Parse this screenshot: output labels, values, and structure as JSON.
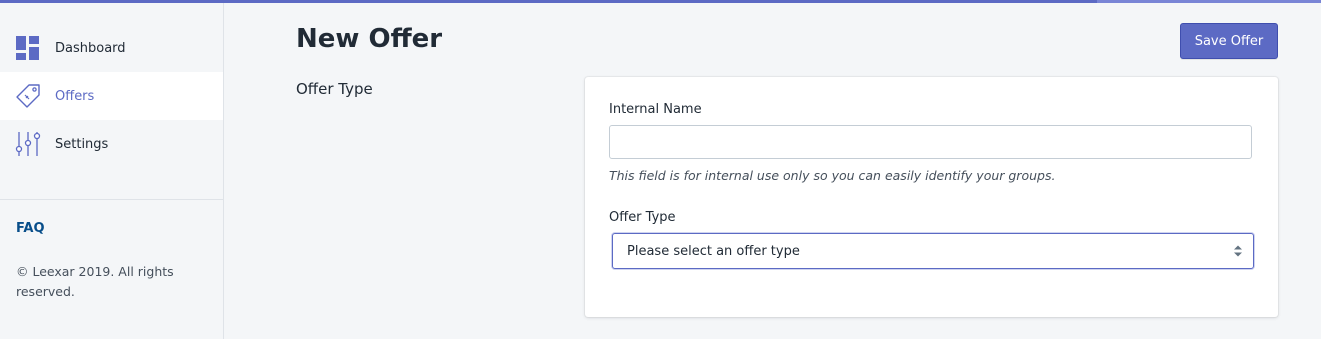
{
  "sidebar": {
    "items": [
      {
        "label": "Dashboard",
        "icon": "dashboard-icon"
      },
      {
        "label": "Offers",
        "icon": "tag-icon",
        "active": true
      },
      {
        "label": "Settings",
        "icon": "sliders-icon"
      }
    ],
    "faq_label": "FAQ",
    "copyright": "© Leexar 2019. All rights reserved."
  },
  "header": {
    "title": "New Offer",
    "save_label": "Save Offer"
  },
  "section": {
    "title": "Offer Type"
  },
  "form": {
    "internal_name_label": "Internal Name",
    "internal_name_value": "",
    "internal_name_help": "This field is for internal use only so you can easily identify your groups.",
    "offer_type_label": "Offer Type",
    "offer_type_selected": "Please select an offer type"
  },
  "colors": {
    "accent": "#5c6ac4",
    "link": "#084e8a",
    "background": "#f4f6f8"
  }
}
